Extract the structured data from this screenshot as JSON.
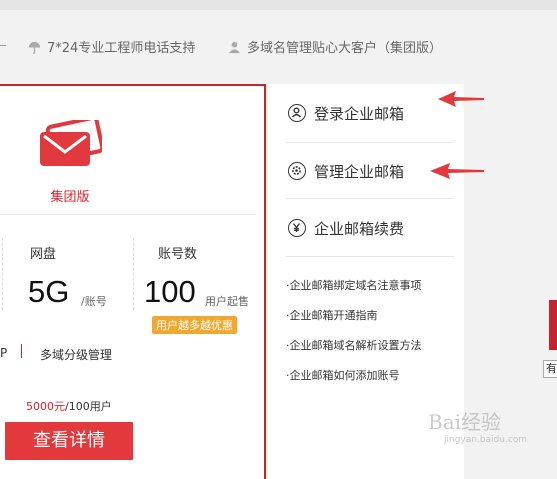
{
  "topbar": {
    "support_text": "7*24专业工程师电话支持",
    "vip_text": "多域名管理贴心大客户（集团版）"
  },
  "card": {
    "edition": "集团版",
    "disk_label": "网盘",
    "disk_value": "5G",
    "disk_unit": "/账号",
    "accounts_label": "账号数",
    "accounts_value": "100",
    "accounts_unit": "用户起售",
    "badge": "用户越多越优惠",
    "feature_left": "P",
    "feature_right": "多域分级管理",
    "price_amount": "5000元",
    "price_unit": "/100用户",
    "detail_button": "查看详情"
  },
  "panel": {
    "menu": [
      {
        "label": "登录企业邮箱",
        "icon": "user-icon"
      },
      {
        "label": "管理企业邮箱",
        "icon": "gear-icon"
      },
      {
        "label": "企业邮箱续费",
        "icon": "yen-icon"
      }
    ],
    "links": [
      "·企业邮箱绑定域名注意事项",
      "·企业邮箱开通指南",
      "·企业邮箱域名解析设置方法",
      "·企业邮箱如何添加账号"
    ]
  },
  "right": {
    "button_partial": "有"
  },
  "watermark": {
    "main": "Bai经验",
    "sub": "jingyan.baidu.com"
  },
  "colors": {
    "brand_red": "#c8232c",
    "button_red": "#e4393c",
    "badge_orange": "#f0a830"
  }
}
